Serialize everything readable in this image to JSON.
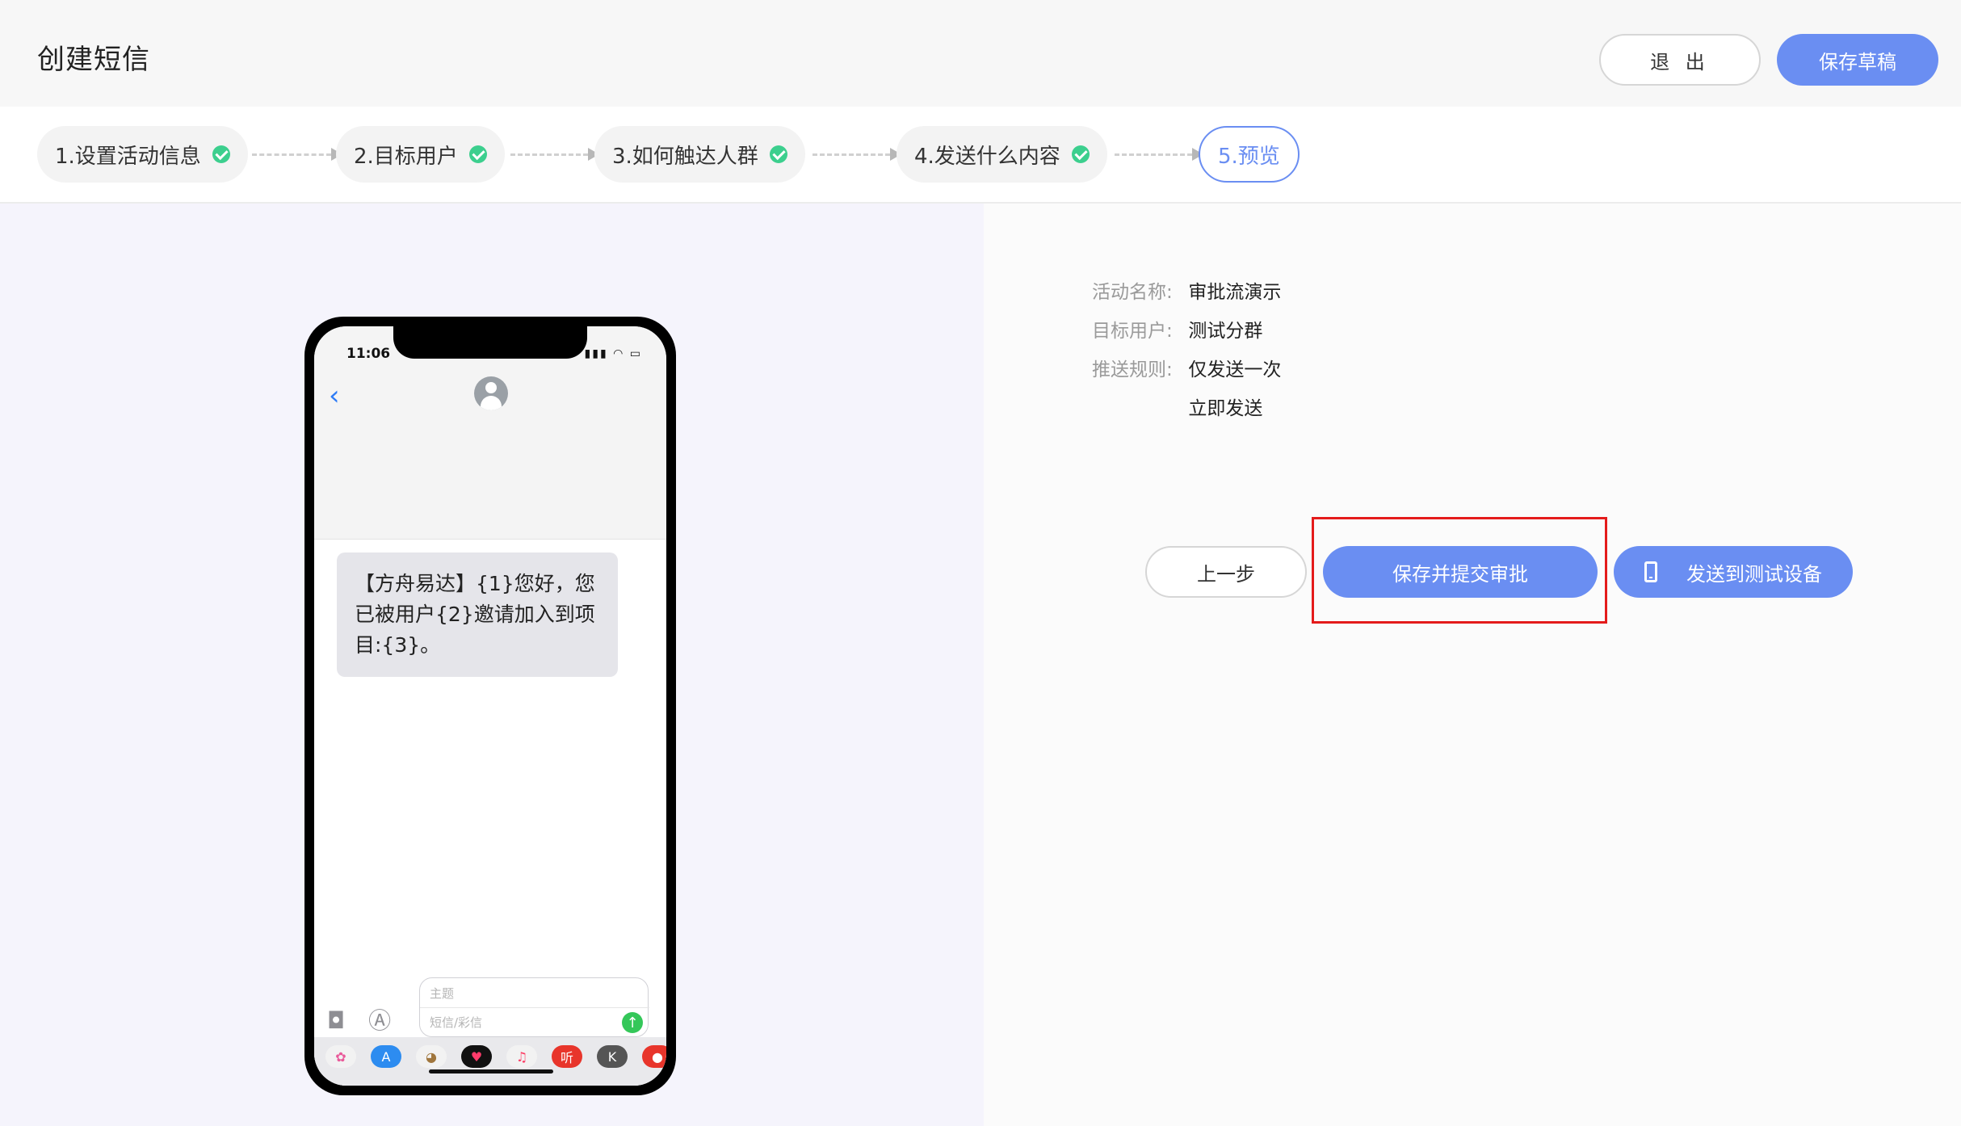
{
  "header": {
    "title": "创建短信",
    "exit_label": "退 出",
    "save_draft_label": "保存草稿"
  },
  "steps": [
    {
      "label": "1.设置活动信息",
      "done": true
    },
    {
      "label": "2.目标用户",
      "done": true
    },
    {
      "label": "3.如何触达人群",
      "done": true
    },
    {
      "label": "4.发送什么内容",
      "done": true
    },
    {
      "label": "5.预览",
      "done": false
    }
  ],
  "phone": {
    "time": "11:06",
    "status_icons": "▮▮▮ ◠ ▭",
    "back_glyph": "‹",
    "message": "【方舟易达】{1}您好，您已被用户{2}邀请加入到项目:{3}。",
    "subject_placeholder": "主题",
    "message_placeholder": "短信/彩信",
    "send_glyph": "↑",
    "camera_glyph": "◘",
    "appstore_glyph": "Ⓐ",
    "apps": [
      "✿",
      "A",
      "◕",
      "♥",
      "♫",
      "听",
      "K",
      "●"
    ]
  },
  "info": {
    "name_label": "活动名称:",
    "name_value": "审批流演示",
    "target_label": "目标用户:",
    "target_value": "测试分群",
    "rule_label": "推送规则:",
    "rule_value_1": "仅发送一次",
    "rule_value_2": "立即发送"
  },
  "actions": {
    "prev_label": "上一步",
    "submit_label": "保存并提交审批",
    "test_label": "发送到测试设备"
  },
  "colors": {
    "accent": "#6a8ef2",
    "check": "#3ccf8e",
    "highlight": "#e41b1b"
  }
}
